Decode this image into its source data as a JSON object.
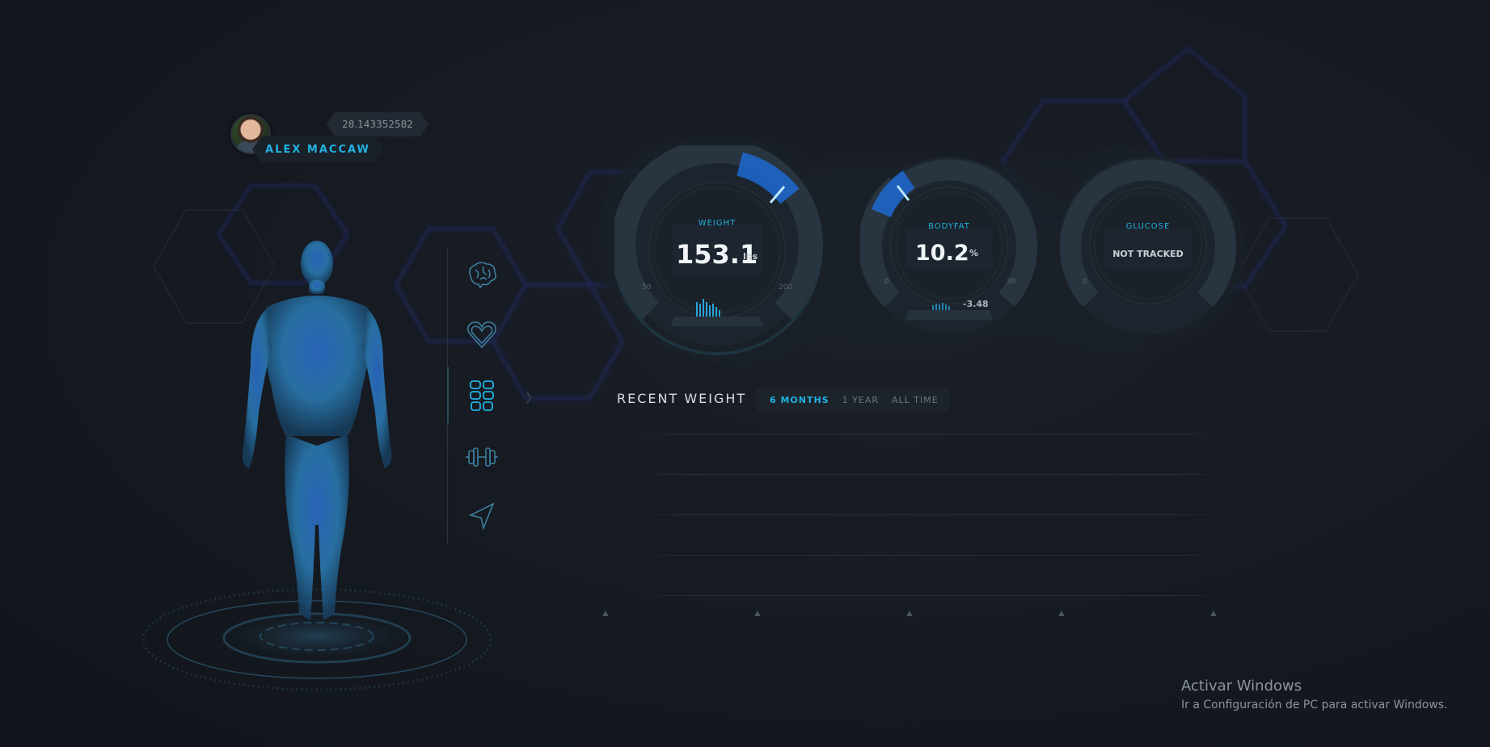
{
  "profile": {
    "name": "ALEX MACCAW",
    "coordinate": "28.143352582",
    "avatar_icon": "user-avatar"
  },
  "nav": {
    "items": [
      {
        "icon": "brain-icon"
      },
      {
        "icon": "heart-icon"
      },
      {
        "icon": "abs-icon",
        "active": true
      },
      {
        "icon": "dumbbell-icon"
      },
      {
        "icon": "navigation-arrow-icon"
      }
    ]
  },
  "gauges": {
    "weight": {
      "label": "WEIGHT",
      "value": "153.1",
      "unit": "lbs",
      "min": "50",
      "max": "200",
      "level": 0.69
    },
    "bodyfat": {
      "label": "BODYFAT",
      "value": "10.2",
      "unit": "%",
      "min": "0",
      "max": "30",
      "delta": "-3.48",
      "level": 0.34
    },
    "glucose": {
      "label": "GLUCOSE",
      "value": "NOT TRACKED",
      "min": "0"
    }
  },
  "recent_weight": {
    "title": "RECENT WEIGHT",
    "tabs": [
      {
        "label": "6 MONTHS",
        "active": true
      },
      {
        "label": "1 YEAR",
        "active": false
      },
      {
        "label": "ALL TIME",
        "active": false
      }
    ]
  },
  "watermark": {
    "title": "Activar Windows",
    "subtitle": "Ir a Configuración de PC para activar Windows."
  },
  "colors": {
    "accent": "#1fb3e3",
    "background": "#151920",
    "hex_glow": "#3b3d9c"
  }
}
